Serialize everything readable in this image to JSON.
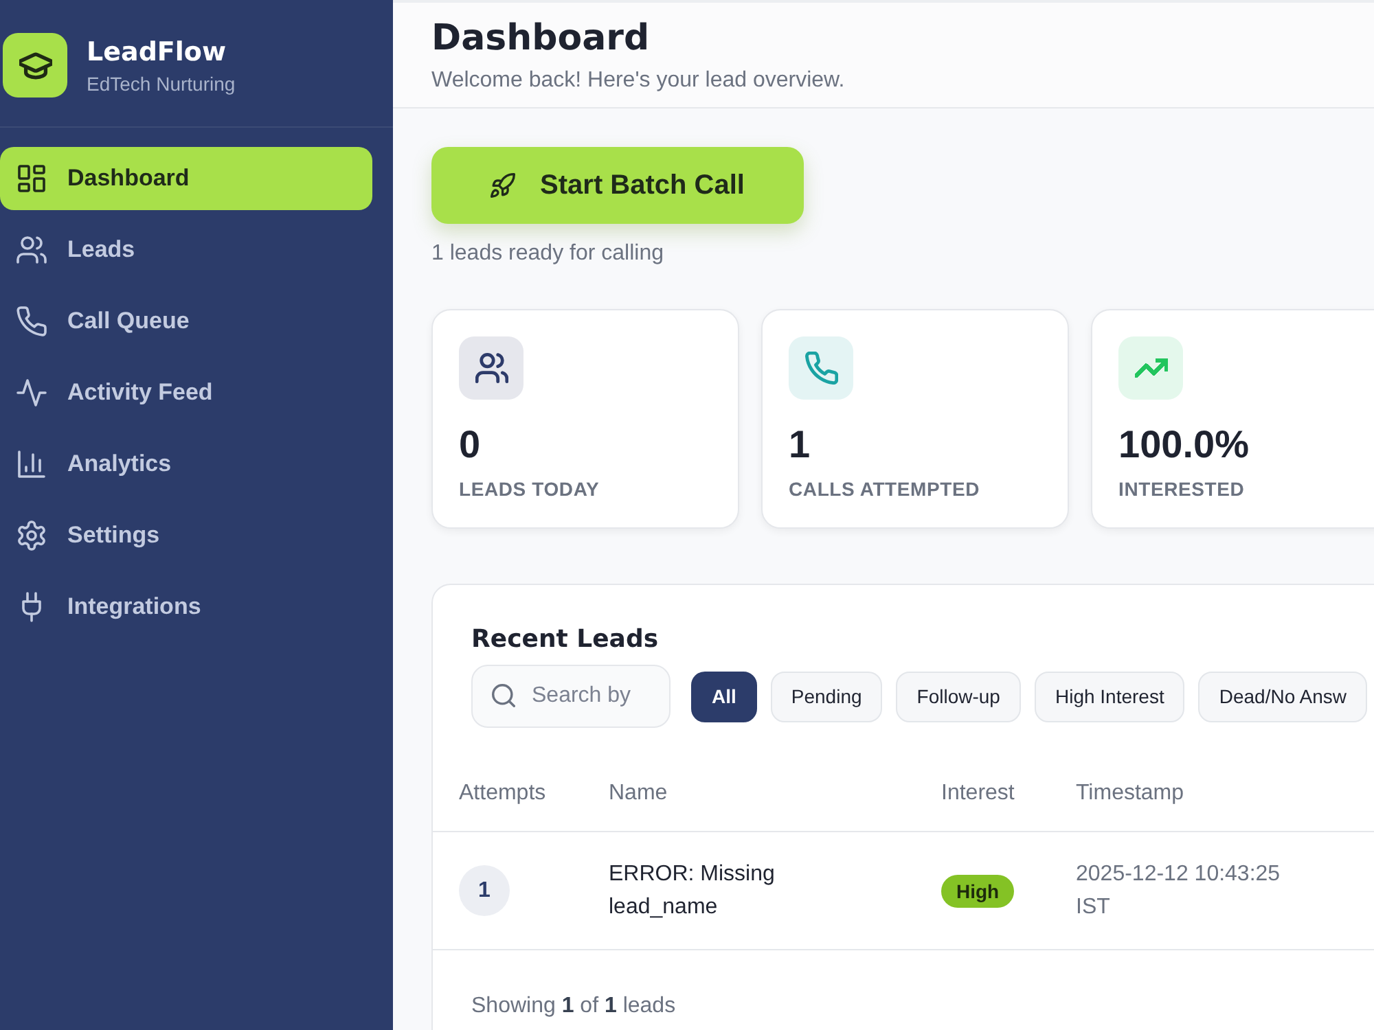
{
  "sidebar": {
    "brand": {
      "name": "LeadFlow",
      "tagline": "EdTech Nurturing"
    },
    "items": [
      {
        "label": "Dashboard",
        "selected": true
      },
      {
        "label": "Leads",
        "selected": false
      },
      {
        "label": "Call Queue",
        "selected": false
      },
      {
        "label": "Activity Feed",
        "selected": false
      },
      {
        "label": "Analytics",
        "selected": false
      },
      {
        "label": "Settings",
        "selected": false
      },
      {
        "label": "Integrations",
        "selected": false
      }
    ]
  },
  "header": {
    "title": "Dashboard",
    "subtitle": "Welcome back! Here's your lead overview."
  },
  "batch": {
    "button": "Start Batch Call",
    "note": "1 leads ready for calling"
  },
  "stats": [
    {
      "value": "0",
      "label": "LEADS TODAY",
      "color": "#2d3b6a"
    },
    {
      "value": "1",
      "label": "CALLS ATTEMPTED",
      "color": "#1aa3a3"
    },
    {
      "value": "100.0%",
      "label": "INTERESTED",
      "color": "#22c55e"
    }
  ],
  "recent_leads": {
    "title": "Recent Leads",
    "search": {
      "placeholder": "Search by"
    },
    "filters": [
      {
        "label": "All",
        "selected": true
      },
      {
        "label": "Pending",
        "selected": false
      },
      {
        "label": "Follow-up",
        "selected": false
      },
      {
        "label": "High Interest",
        "selected": false
      },
      {
        "label": "Dead/No Answ",
        "selected": false
      }
    ],
    "table": {
      "columns": [
        "Attempts",
        "Name",
        "Interest",
        "Timestamp"
      ],
      "rows": [
        {
          "attempts": "1",
          "name": "ERROR: Missing lead_name",
          "interest": "High",
          "timestamp": "2025-12-12 10:43:25 IST"
        }
      ]
    },
    "footer": "Showing **1** of **1** leads"
  }
}
